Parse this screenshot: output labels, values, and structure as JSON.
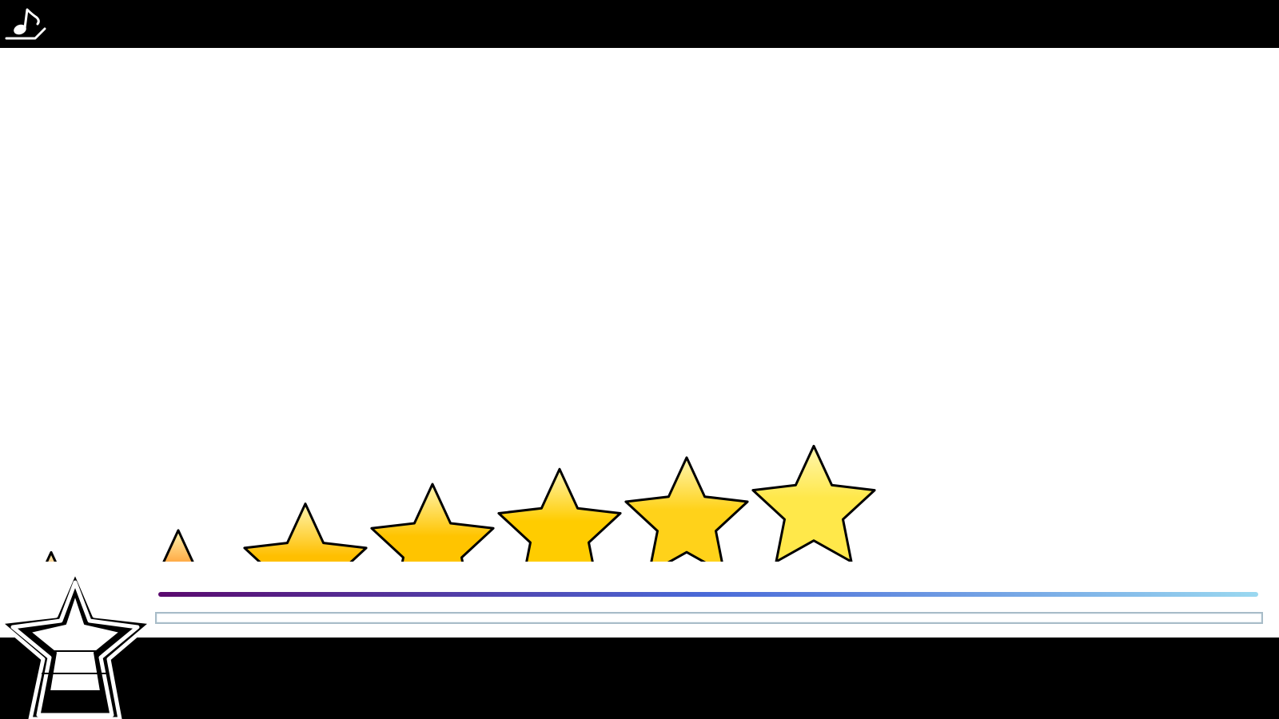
{
  "toolbar": {
    "music_icon": "music-note-icon"
  },
  "rating": {
    "stars_total": 7,
    "stars_revealed": 7,
    "star_colors": [
      "#c8140a",
      "#ff7a00",
      "#ffbf00",
      "#ffc400",
      "#ffcc00",
      "#ffd21a",
      "#ffe84a"
    ]
  },
  "power_meter": {
    "gradient_colors": [
      "#5a0a6e",
      "#4a6ad8",
      "#9ad8f0"
    ],
    "level": 0
  },
  "badge": {
    "icon": "star-badge-icon",
    "color": "#ffffff"
  },
  "colors": {
    "bar": "#000000",
    "background": "#ffffff",
    "track_border": "#a8bcc8"
  }
}
